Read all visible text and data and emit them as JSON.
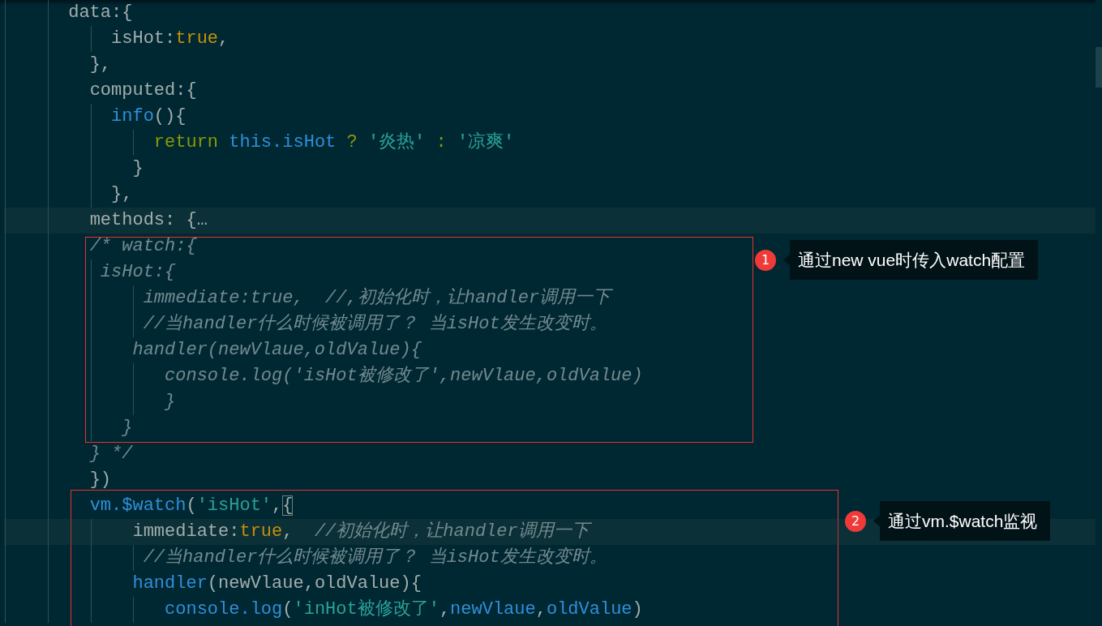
{
  "editor": {
    "lines": [
      {
        "highlighted": false,
        "tokens": [
          {
            "kind": "plain",
            "text": "      data:{"
          }
        ]
      },
      {
        "highlighted": false,
        "tokens": [
          {
            "kind": "plain",
            "text": "          isHot:"
          },
          {
            "kind": "keyword",
            "text": "true"
          },
          {
            "kind": "plain",
            "text": ","
          }
        ]
      },
      {
        "highlighted": false,
        "tokens": [
          {
            "kind": "plain",
            "text": "        },"
          }
        ]
      },
      {
        "highlighted": false,
        "tokens": [
          {
            "kind": "plain",
            "text": "        computed:{"
          }
        ]
      },
      {
        "highlighted": false,
        "tokens": [
          {
            "kind": "function",
            "text": "          info"
          },
          {
            "kind": "plain",
            "text": "(){"
          }
        ]
      },
      {
        "highlighted": false,
        "tokens": [
          {
            "kind": "control",
            "text": "              return"
          },
          {
            "kind": "function",
            "text": " this.isHot"
          },
          {
            "kind": "control",
            "text": " ?"
          },
          {
            "kind": "string",
            "text": " '炎热'"
          },
          {
            "kind": "control",
            "text": " :"
          },
          {
            "kind": "string",
            "text": " '凉爽'"
          }
        ]
      },
      {
        "highlighted": false,
        "tokens": [
          {
            "kind": "plain",
            "text": "            }"
          }
        ]
      },
      {
        "highlighted": false,
        "tokens": [
          {
            "kind": "plain",
            "text": "          },"
          }
        ]
      },
      {
        "highlighted": true,
        "tokens": [
          {
            "kind": "plain",
            "text": "        methods: {…"
          }
        ]
      },
      {
        "highlighted": false,
        "tokens": [
          {
            "kind": "comment",
            "text": "        /* watch:{"
          }
        ]
      },
      {
        "highlighted": false,
        "tokens": [
          {
            "kind": "comment",
            "text": "         isHot:{"
          }
        ]
      },
      {
        "highlighted": false,
        "tokens": [
          {
            "kind": "comment",
            "text": "             immediate:true,  //,初始化时，让handler调用一下"
          }
        ]
      },
      {
        "highlighted": false,
        "tokens": [
          {
            "kind": "comment",
            "text": "             //当handler什么时候被调用了？ 当isHot发生改变时。"
          }
        ]
      },
      {
        "highlighted": false,
        "tokens": [
          {
            "kind": "comment",
            "text": "            handler(newVlaue,oldValue){"
          }
        ]
      },
      {
        "highlighted": false,
        "tokens": [
          {
            "kind": "comment",
            "text": "               console.log('isHot被修改了',newVlaue,oldValue)"
          }
        ]
      },
      {
        "highlighted": false,
        "tokens": [
          {
            "kind": "comment",
            "text": "               }"
          }
        ]
      },
      {
        "highlighted": false,
        "tokens": [
          {
            "kind": "comment",
            "text": "           }"
          }
        ]
      },
      {
        "highlighted": false,
        "tokens": [
          {
            "kind": "comment",
            "text": "        } */"
          }
        ]
      },
      {
        "highlighted": false,
        "tokens": [
          {
            "kind": "plain",
            "text": "        })"
          }
        ]
      },
      {
        "highlighted": false,
        "tokens": [
          {
            "kind": "function",
            "text": "        vm.$watch"
          },
          {
            "kind": "plain",
            "text": "("
          },
          {
            "kind": "string",
            "text": "'isHot'"
          },
          {
            "kind": "plain",
            "text": ","
          },
          {
            "kind": "matched",
            "text": "{"
          }
        ]
      },
      {
        "highlighted": true,
        "tokens": [
          {
            "kind": "plain",
            "text": "            immediate:"
          },
          {
            "kind": "keyword",
            "text": "true"
          },
          {
            "kind": "plain",
            "text": ","
          },
          {
            "kind": "comment",
            "text": "  //初始化时，让handler调用一下"
          }
        ]
      },
      {
        "highlighted": false,
        "tokens": [
          {
            "kind": "comment",
            "text": "             //当handler什么时候被调用了？ 当isHot发生改变时。"
          }
        ]
      },
      {
        "highlighted": false,
        "tokens": [
          {
            "kind": "function",
            "text": "            handler"
          },
          {
            "kind": "plain",
            "text": "(newVlaue,oldValue){"
          }
        ]
      },
      {
        "highlighted": false,
        "tokens": [
          {
            "kind": "function",
            "text": "               console.log"
          },
          {
            "kind": "plain",
            "text": "("
          },
          {
            "kind": "string",
            "text": "'inHot被修改了'"
          },
          {
            "kind": "plain",
            "text": ","
          },
          {
            "kind": "function",
            "text": "newVlaue"
          },
          {
            "kind": "plain",
            "text": ","
          },
          {
            "kind": "function",
            "text": "oldValue"
          },
          {
            "kind": "plain",
            "text": ")"
          }
        ]
      }
    ]
  },
  "annotations": [
    {
      "number": "1",
      "text": "通过new vue时传入watch配置"
    },
    {
      "number": "2",
      "text": "通过vm.$watch监视"
    }
  ]
}
